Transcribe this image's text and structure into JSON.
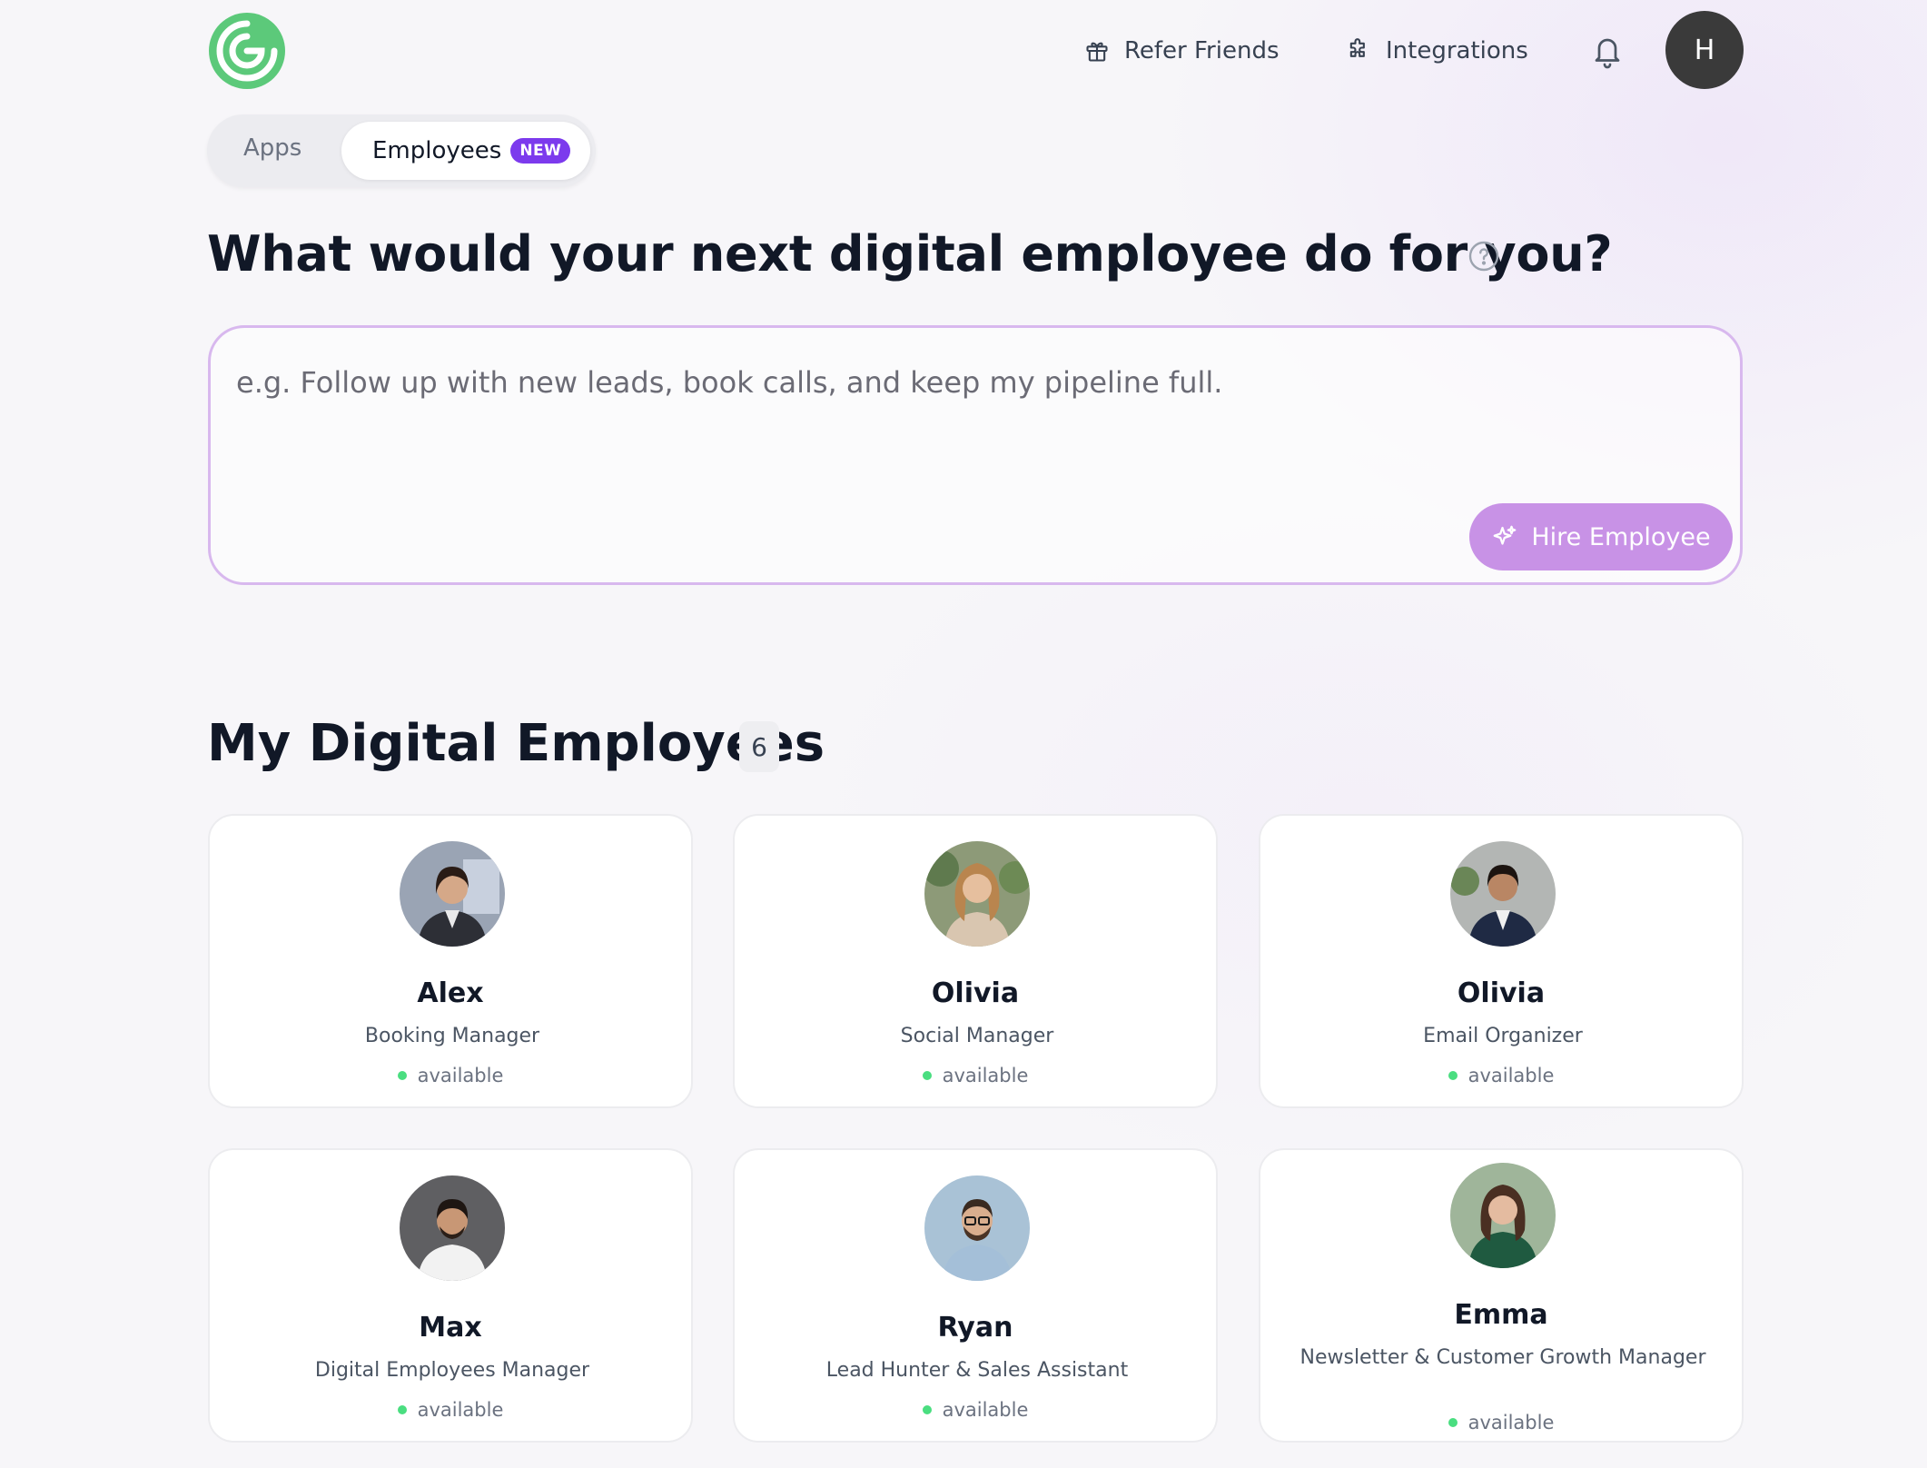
{
  "header": {
    "refer_label": "Refer Friends",
    "integrations_label": "Integrations",
    "user_initial": "H"
  },
  "tabs": {
    "apps_label": "Apps",
    "employees_label": "Employees",
    "employees_badge": "NEW"
  },
  "hero": {
    "title": "What would your next digital employee do for you?",
    "placeholder": "e.g. Follow up with new leads, book calls, and keep my pipeline full.",
    "hire_label": "Hire Employee"
  },
  "employees": {
    "title": "My Digital Employees",
    "count": "6",
    "items": [
      {
        "name": "Alex",
        "role": "Booking Manager",
        "status": "available"
      },
      {
        "name": "Olivia",
        "role": "Social Manager",
        "status": "available"
      },
      {
        "name": "Olivia",
        "role": "Email Organizer",
        "status": "available"
      },
      {
        "name": "Max",
        "role": "Digital Employees Manager",
        "status": "available"
      },
      {
        "name": "Ryan",
        "role": "Lead Hunter & Sales Assistant",
        "status": "available"
      },
      {
        "name": "Emma",
        "role": "Newsletter & Customer Growth Manager",
        "status": "available"
      }
    ]
  },
  "colors": {
    "brand_green": "#5cc97a",
    "accent_purple": "#7c3aed",
    "hire_button": "#c892e6",
    "status_available": "#4ade80"
  }
}
